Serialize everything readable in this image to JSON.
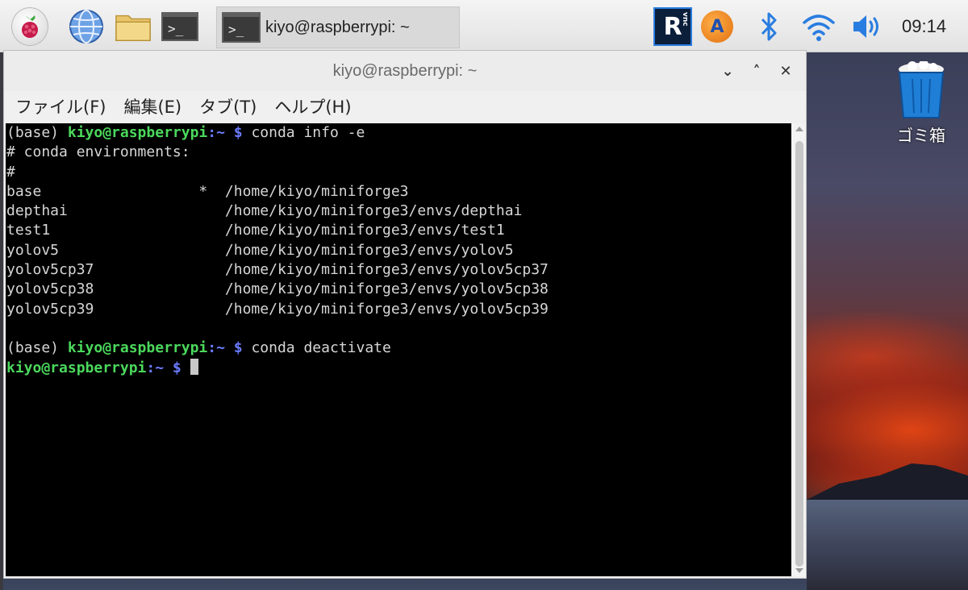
{
  "taskbar": {
    "task_window_label": "kiyo@raspberrypi: ~",
    "terminal_glyph": ">_",
    "clock": "09:14",
    "vnc_letter": "R",
    "vnc_small": "vnc",
    "update_letter": "A"
  },
  "desktop": {
    "trash_label": "ゴミ箱"
  },
  "window": {
    "title": "kiyo@raspberrypi: ~",
    "controls": {
      "minimize": "⌄",
      "maximize": "˄",
      "close": "✕"
    },
    "menu": [
      "ファイル(F)",
      "編集(E)",
      "タブ(T)",
      "ヘルプ(H)"
    ]
  },
  "terminal": {
    "prompt_prefix": "(base) ",
    "user_host": "kiyo@raspberrypi",
    "path": ":~",
    "dollar": " $ ",
    "cmd1": "conda info -e",
    "lines": [
      "# conda environments:",
      "#",
      "base                  *  /home/kiyo/miniforge3",
      "depthai                  /home/kiyo/miniforge3/envs/depthai",
      "test1                    /home/kiyo/miniforge3/envs/test1",
      "yolov5                   /home/kiyo/miniforge3/envs/yolov5",
      "yolov5cp37               /home/kiyo/miniforge3/envs/yolov5cp37",
      "yolov5cp38               /home/kiyo/miniforge3/envs/yolov5cp38",
      "yolov5cp39               /home/kiyo/miniforge3/envs/yolov5cp39"
    ],
    "cmd2": "conda deactivate"
  },
  "colors": {
    "prompt_user": "#4bd85c",
    "prompt_dollar": "#6a7cff",
    "terminal_bg": "#000000"
  }
}
